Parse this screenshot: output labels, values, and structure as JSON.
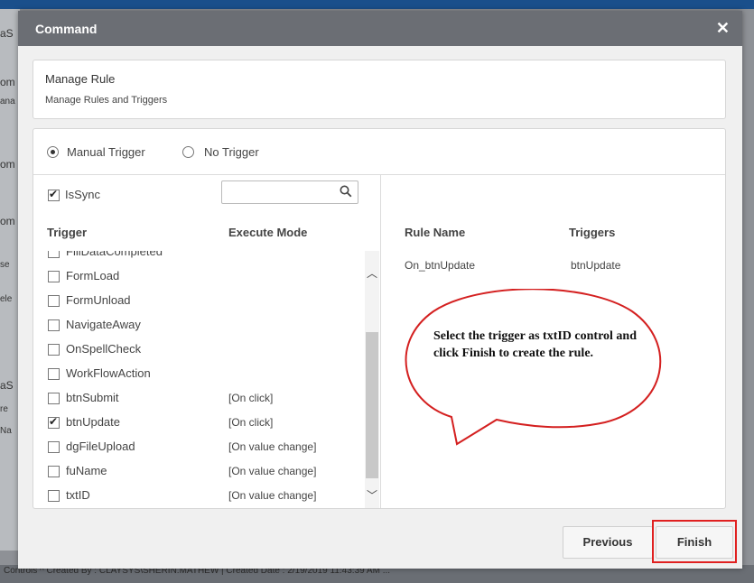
{
  "background": {
    "left_fragments": [
      "aS",
      "om",
      "ana",
      "om",
      "om",
      "se",
      "ele",
      "aS",
      "re",
      "Na"
    ],
    "footer": "Controls  ^     Created By : CLAYSYS\\SHERIN.MATHEW | Created Date : 2/19/2019 11:43:39 AM  ..."
  },
  "dialog": {
    "title": "Command",
    "close_icon": "close-icon"
  },
  "rule": {
    "title": "Manage Rule",
    "subtitle": "Manage Rules and Triggers"
  },
  "trigger_mode": {
    "options": [
      {
        "label": "Manual Trigger",
        "selected": true
      },
      {
        "label": "No Trigger",
        "selected": false
      }
    ]
  },
  "left": {
    "is_sync_label": "IsSync",
    "is_sync_checked": true,
    "search_placeholder": "",
    "search_icon": "search-icon",
    "col_trigger": "Trigger",
    "col_execute": "Execute Mode",
    "items": [
      {
        "label": "FillDataCompleted",
        "mode": "",
        "checked": false
      },
      {
        "label": "FormLoad",
        "mode": "",
        "checked": false
      },
      {
        "label": "FormUnload",
        "mode": "",
        "checked": false
      },
      {
        "label": "NavigateAway",
        "mode": "",
        "checked": false
      },
      {
        "label": "OnSpellCheck",
        "mode": "",
        "checked": false
      },
      {
        "label": "WorkFlowAction",
        "mode": "",
        "checked": false
      },
      {
        "label": "btnSubmit",
        "mode": "[On click]",
        "checked": false
      },
      {
        "label": "btnUpdate",
        "mode": "[On click]",
        "checked": true
      },
      {
        "label": "dgFileUpload",
        "mode": "[On value change]",
        "checked": false
      },
      {
        "label": "fuName",
        "mode": "[On value change]",
        "checked": false
      },
      {
        "label": "txtID",
        "mode": "[On value change]",
        "checked": false
      }
    ]
  },
  "right": {
    "col_rule_name": "Rule Name",
    "col_triggers": "Triggers",
    "rows": [
      {
        "rule_name": "On_btnUpdate",
        "triggers": "btnUpdate"
      }
    ]
  },
  "buttons": {
    "previous": "Previous",
    "finish": "Finish"
  },
  "annotation": {
    "text": "Select the trigger as txtID control and click Finish to create the rule.",
    "color": "#d42020"
  }
}
